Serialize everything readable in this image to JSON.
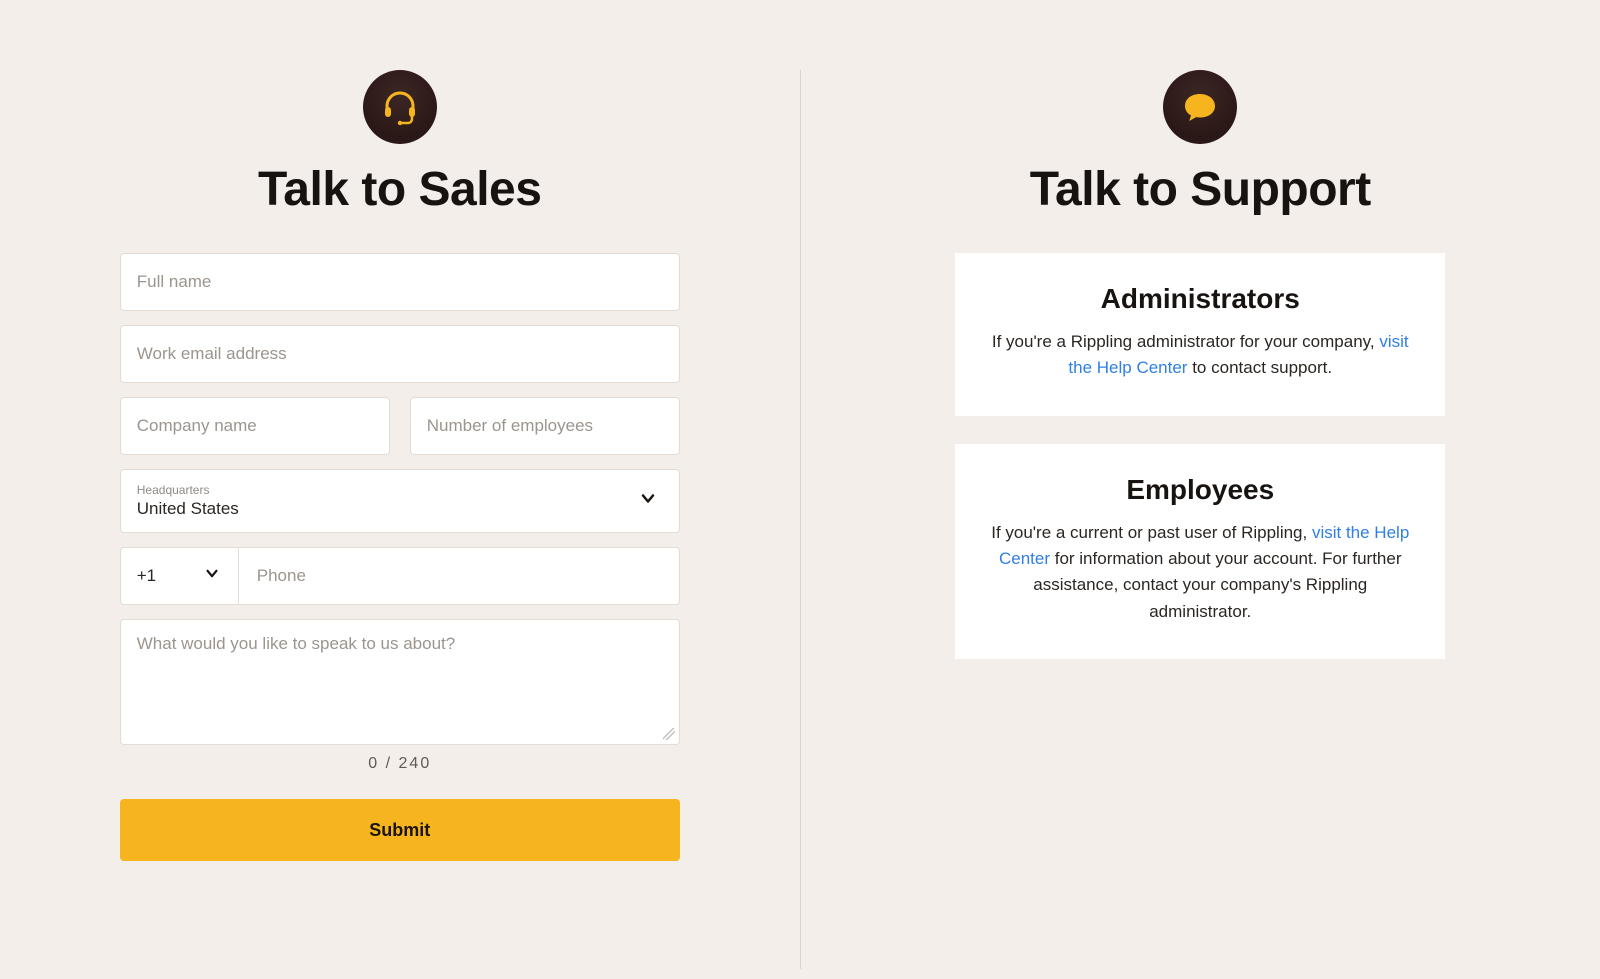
{
  "sales": {
    "title": "Talk to Sales",
    "full_name_placeholder": "Full name",
    "email_placeholder": "Work email address",
    "company_placeholder": "Company name",
    "employees_placeholder": "Number of employees",
    "headquarters_label": "Headquarters",
    "headquarters_value": "United States",
    "phone_code": "+1",
    "phone_placeholder": "Phone",
    "message_placeholder": "What would you like to speak to us about?",
    "counter": "0 / 240",
    "submit_label": "Submit"
  },
  "support": {
    "title": "Talk to Support",
    "cards": [
      {
        "heading": "Administrators",
        "text_before": "If you're a Rippling administrator for your company, ",
        "link_text": "visit the Help Center",
        "text_after": " to contact support."
      },
      {
        "heading": "Employees",
        "text_before": "If you're a current or past user of Rippling, ",
        "link_text": "visit the Help Center",
        "text_after": " for information about your account. For further assistance, contact your company's Rippling administrator."
      }
    ]
  }
}
